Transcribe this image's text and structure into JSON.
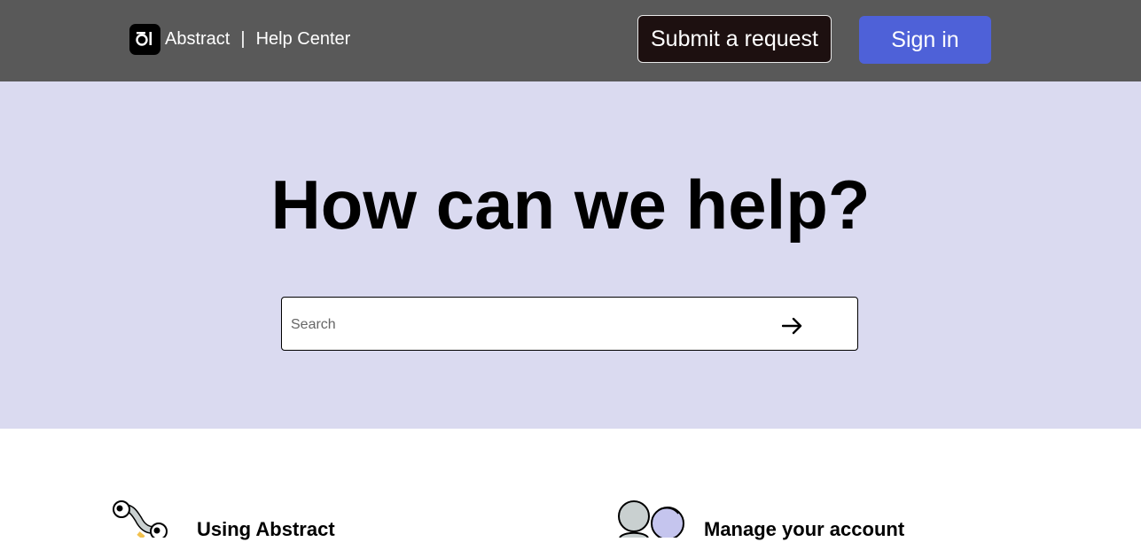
{
  "header": {
    "brand_name": "Abstract",
    "separator": "|",
    "section_name": "Help Center",
    "submit_label": "Submit a request",
    "signin_label": "Sign in"
  },
  "hero": {
    "title": "How can we help?",
    "search": {
      "placeholder": "Search",
      "value": ""
    }
  },
  "categories": [
    {
      "title": "Using Abstract",
      "icon": "worm-characters-illustration"
    },
    {
      "title": "Manage your account",
      "icon": "people-circles-illustration"
    }
  ],
  "colors": {
    "header_bg": "#595959",
    "hero_bg": "#dadaf0",
    "submit_bg": "#1d1010",
    "signin_bg": "#4e61d8"
  }
}
